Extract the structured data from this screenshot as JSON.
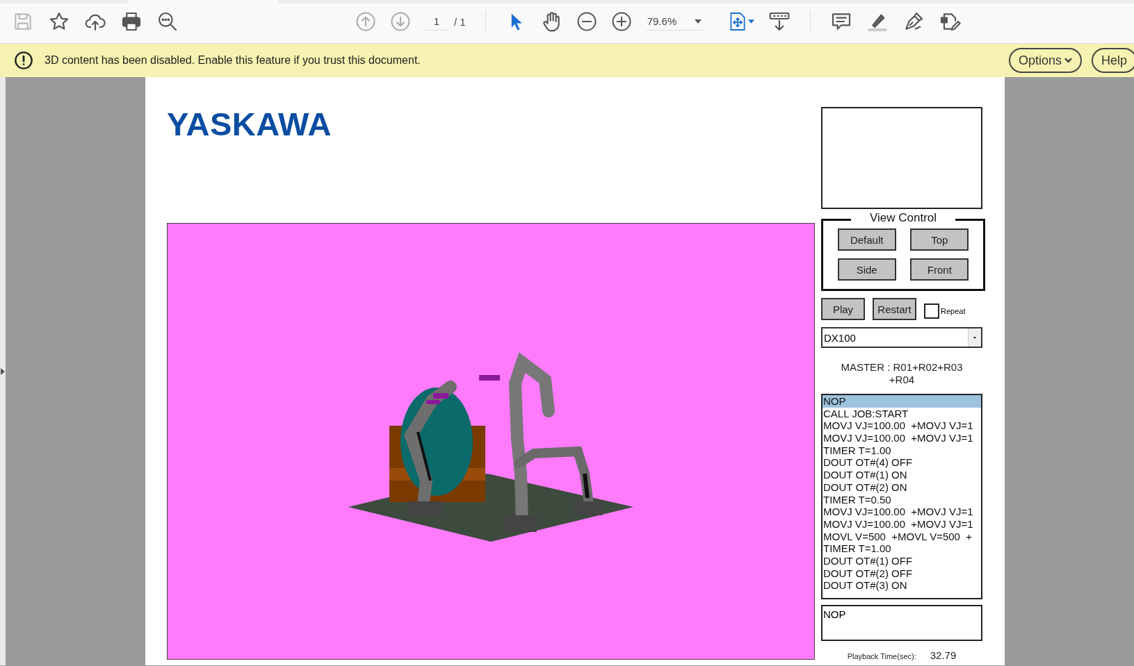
{
  "toolbar": {
    "page_current": "1",
    "page_total": "/ 1",
    "zoom": "79.6%"
  },
  "notification": {
    "message": "3D content has been disabled. Enable this feature if you trust this document.",
    "buttons": [
      "Options",
      "Help"
    ]
  },
  "document": {
    "logo": "YASKAWA",
    "view_control": {
      "title": "View Control",
      "buttons": [
        "Default",
        "Top",
        "Side",
        "Front"
      ]
    },
    "playback_buttons": [
      "Play",
      "Restart"
    ],
    "repeat": {
      "label": "Repeat",
      "checked": false
    },
    "controller_select": {
      "value": "DX100"
    },
    "master": "MASTER : R01+R02+R03 +R04",
    "job_lines": [
      {
        "text": "NOP",
        "selected": true
      },
      {
        "text": "CALL JOB:START",
        "selected": false
      },
      {
        "text": "MOVJ VJ=100.00  +MOVJ VJ=1",
        "selected": false
      },
      {
        "text": "MOVJ VJ=100.00  +MOVJ VJ=1",
        "selected": false
      },
      {
        "text": "TIMER T=1.00",
        "selected": false
      },
      {
        "text": "DOUT OT#(4) OFF",
        "selected": false
      },
      {
        "text": "DOUT OT#(1) ON",
        "selected": false
      },
      {
        "text": "DOUT OT#(2) ON",
        "selected": false
      },
      {
        "text": "TIMER T=0.50",
        "selected": false
      },
      {
        "text": "MOVJ VJ=100.00  +MOVJ VJ=1",
        "selected": false
      },
      {
        "text": "MOVJ VJ=100.00  +MOVJ VJ=1",
        "selected": false
      },
      {
        "text": "MOVL V=500  +MOVL V=500  +",
        "selected": false
      },
      {
        "text": "TIMER T=1.00",
        "selected": false
      },
      {
        "text": "DOUT OT#(1) OFF",
        "selected": false
      },
      {
        "text": "DOUT OT#(2) OFF",
        "selected": false
      },
      {
        "text": "DOUT OT#(3) ON",
        "selected": false
      }
    ],
    "current_line": "NOP",
    "playback_time": {
      "label": "Playback Time(sec):",
      "value": "32.79"
    }
  }
}
